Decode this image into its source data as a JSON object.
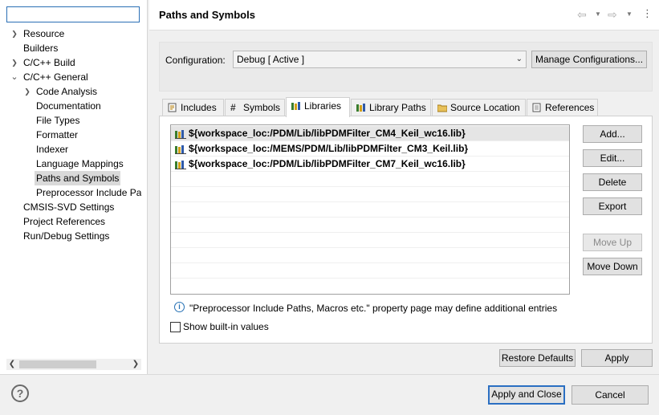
{
  "sidebar": {
    "filter_value": "",
    "items": [
      {
        "label": "Resource",
        "arrow": "›"
      },
      {
        "label": "Builders",
        "arrow": ""
      },
      {
        "label": "C/C++ Build",
        "arrow": "›"
      },
      {
        "label": "C/C++ General",
        "arrow": "⌄"
      },
      {
        "label": "Code Analysis",
        "arrow": "›"
      },
      {
        "label": "Documentation",
        "arrow": ""
      },
      {
        "label": "File Types",
        "arrow": ""
      },
      {
        "label": "Formatter",
        "arrow": ""
      },
      {
        "label": "Indexer",
        "arrow": ""
      },
      {
        "label": "Language Mappings",
        "arrow": ""
      },
      {
        "label": "Paths and Symbols",
        "arrow": ""
      },
      {
        "label": "Preprocessor Include Pat",
        "arrow": ""
      },
      {
        "label": "CMSIS-SVD Settings",
        "arrow": ""
      },
      {
        "label": "Project References",
        "arrow": ""
      },
      {
        "label": "Run/Debug Settings",
        "arrow": ""
      }
    ],
    "selected": "Paths and Symbols"
  },
  "header": {
    "title": "Paths and Symbols",
    "icons": [
      "back-arrow-icon",
      "chevron-down-icon",
      "forward-arrow-icon",
      "chevron-down-icon",
      "more-vert-icon"
    ]
  },
  "config": {
    "label": "Configuration:",
    "selected": "Debug  [ Active ]",
    "manage_button": "Manage Configurations..."
  },
  "tabs": [
    {
      "label": "Includes",
      "icon": "includes-icon"
    },
    {
      "label": "Symbols",
      "icon": "hash-icon"
    },
    {
      "label": "Libraries",
      "icon": "library-icon"
    },
    {
      "label": "Library Paths",
      "icon": "library-icon"
    },
    {
      "label": "Source Location",
      "icon": "folder-icon"
    },
    {
      "label": "References",
      "icon": "references-icon"
    }
  ],
  "active_tab": "Libraries",
  "libraries": [
    "${workspace_loc:/PDM/Lib/libPDMFilter_CM4_Keil_wc16.lib}",
    "${workspace_loc:/MEMS/PDM/Lib/libPDMFilter_CM3_Keil.lib}",
    "${workspace_loc:/PDM/Lib/libPDMFilter_CM7_Keil_wc16.lib}"
  ],
  "side_buttons": {
    "add": "Add...",
    "edit": "Edit...",
    "delete": "Delete",
    "export": "Export",
    "move_up": "Move Up",
    "move_down": "Move Down"
  },
  "info_text": "\"Preprocessor Include Paths, Macros etc.\" property page may define additional entries",
  "show_builtin_label": "Show built-in values",
  "show_builtin_checked": false,
  "buttons": {
    "restore_defaults": "Restore Defaults",
    "apply": "Apply",
    "apply_and_close": "Apply and Close",
    "cancel": "Cancel"
  },
  "colors": {
    "accent": "#2b6fc2",
    "selection": "#d9d9d9"
  }
}
